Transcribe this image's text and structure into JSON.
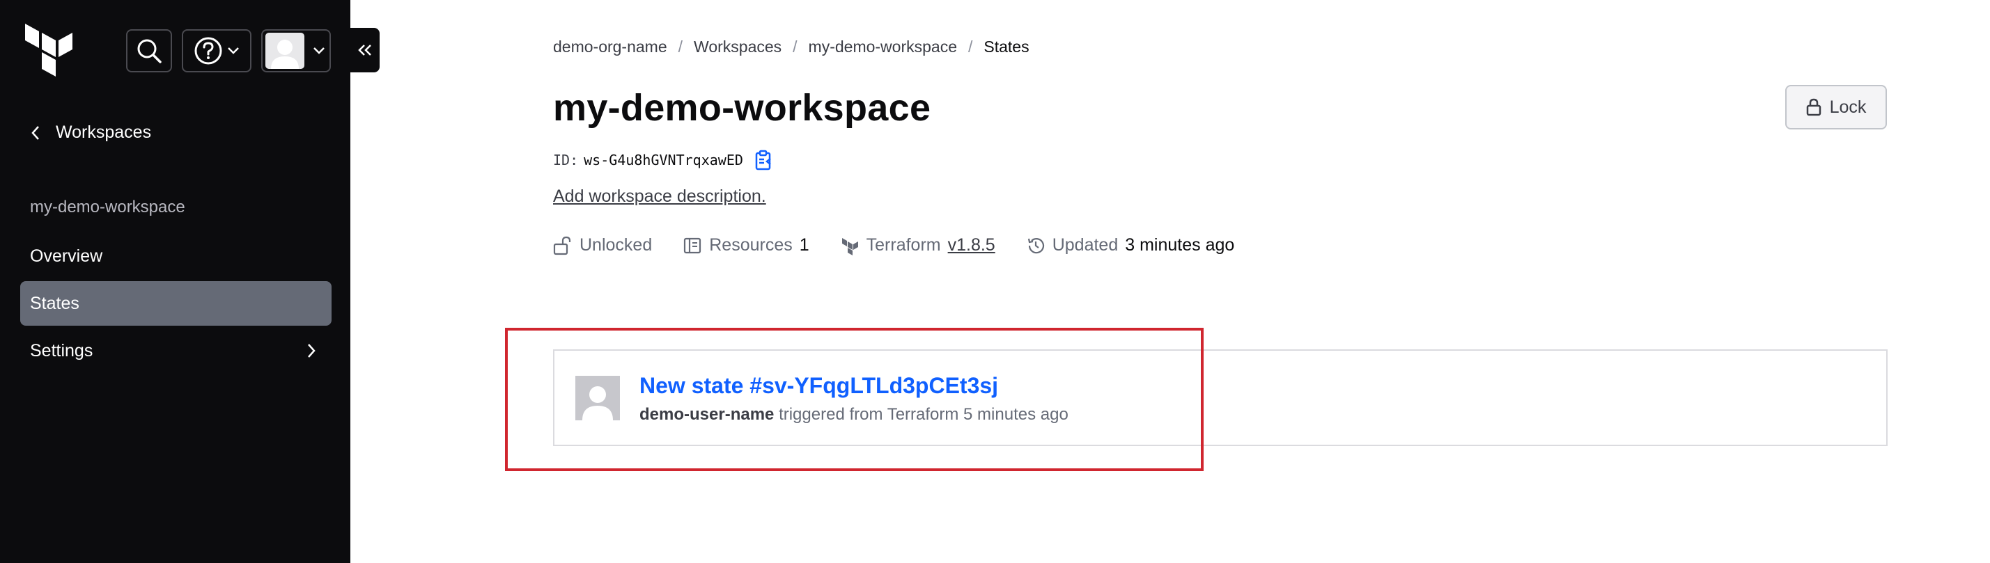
{
  "sidebar": {
    "back_label": "Workspaces",
    "workspace_name": "my-demo-workspace",
    "nav": {
      "overview": "Overview",
      "states": "States",
      "settings": "Settings"
    }
  },
  "breadcrumb": {
    "org": "demo-org-name",
    "workspaces": "Workspaces",
    "workspace": "my-demo-workspace",
    "current": "States",
    "separator": "/"
  },
  "header": {
    "title": "my-demo-workspace",
    "lock_label": "Lock",
    "id_label": "ID:",
    "id_value": "ws-G4u8hGVNTrqxawED",
    "add_description": "Add workspace description."
  },
  "meta": {
    "lock_status": "Unlocked",
    "resources_label": "Resources",
    "resources_count": "1",
    "terraform_label": "Terraform",
    "terraform_version": "v1.8.5",
    "updated_label": "Updated",
    "updated_value": "3 minutes ago"
  },
  "states": [
    {
      "title": "New state #sv-YFqgLTLd3pCEt3sj",
      "user": "demo-user-name",
      "detail": "triggered from Terraform 5 minutes ago"
    }
  ],
  "colors": {
    "sidebar_bg": "#0c0c0e",
    "active_nav_bg": "#656a76",
    "link_blue": "#1060ff",
    "highlight_red": "#d0262f"
  }
}
